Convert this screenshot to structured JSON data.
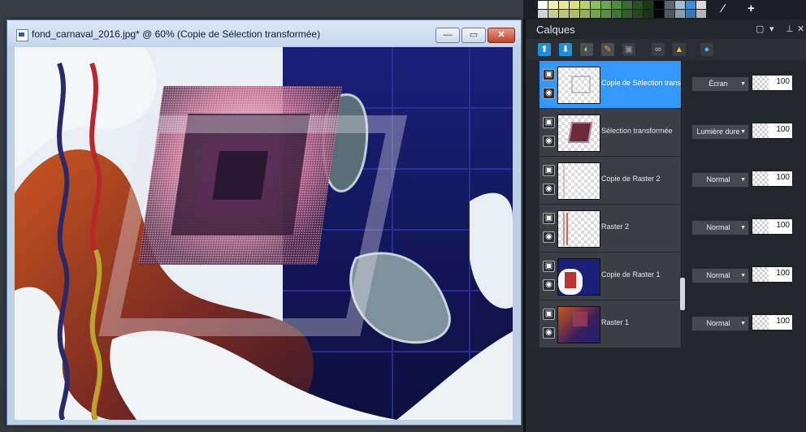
{
  "document_window": {
    "title": "fond_carnaval_2016.jpg* @  60% (Copie de Sélection transformée)",
    "buttons": {
      "minimize": "—",
      "restore": "▭",
      "close": "✕"
    }
  },
  "palette": {
    "swatch_colors": [
      "#ffffff",
      "#f3f4b0",
      "#e9eb94",
      "#d8e27a",
      "#b7d36a",
      "#8fc15a",
      "#6aa84b",
      "#4e8b3c",
      "#3a6d31",
      "#27511f",
      "#1c3913",
      "#000000",
      "#5b6671",
      "#a6bdd1",
      "#3f8fd5",
      "#d9d9d9"
    ],
    "tool_icons": [
      "eyedropper-icon",
      "plus-icon"
    ]
  },
  "layers_panel": {
    "title": "Calques",
    "header_buttons": [
      "▢",
      "▾",
      "✕"
    ],
    "toolbar_icons": [
      "new-layer-icon",
      "new-layer-from-selection-icon",
      "mask-icon",
      "adjust-icon",
      "raster-icon",
      "link-icon",
      "lock-icon",
      "palette-icon"
    ],
    "layers": [
      {
        "name": "Copie de Sélection transformée",
        "blend": "Écran",
        "opacity": "100",
        "selected": true,
        "thumb": "selection-copy"
      },
      {
        "name": "Sélection transformée",
        "blend": "Lumière dure",
        "opacity": "100",
        "selected": false,
        "thumb": "selection"
      },
      {
        "name": "Copie de Raster 2",
        "blend": "Normal",
        "opacity": "100",
        "selected": false,
        "thumb": "raster2-copy"
      },
      {
        "name": "Raster 2",
        "blend": "Normal",
        "opacity": "100",
        "selected": false,
        "thumb": "raster2"
      },
      {
        "name": "Copie de Raster 1",
        "blend": "Normal",
        "opacity": "100",
        "selected": false,
        "thumb": "raster1-copy"
      },
      {
        "name": "Raster 1",
        "blend": "Normal",
        "opacity": "100",
        "selected": false,
        "thumb": "raster1"
      }
    ],
    "selection_color": "#3399ff"
  }
}
